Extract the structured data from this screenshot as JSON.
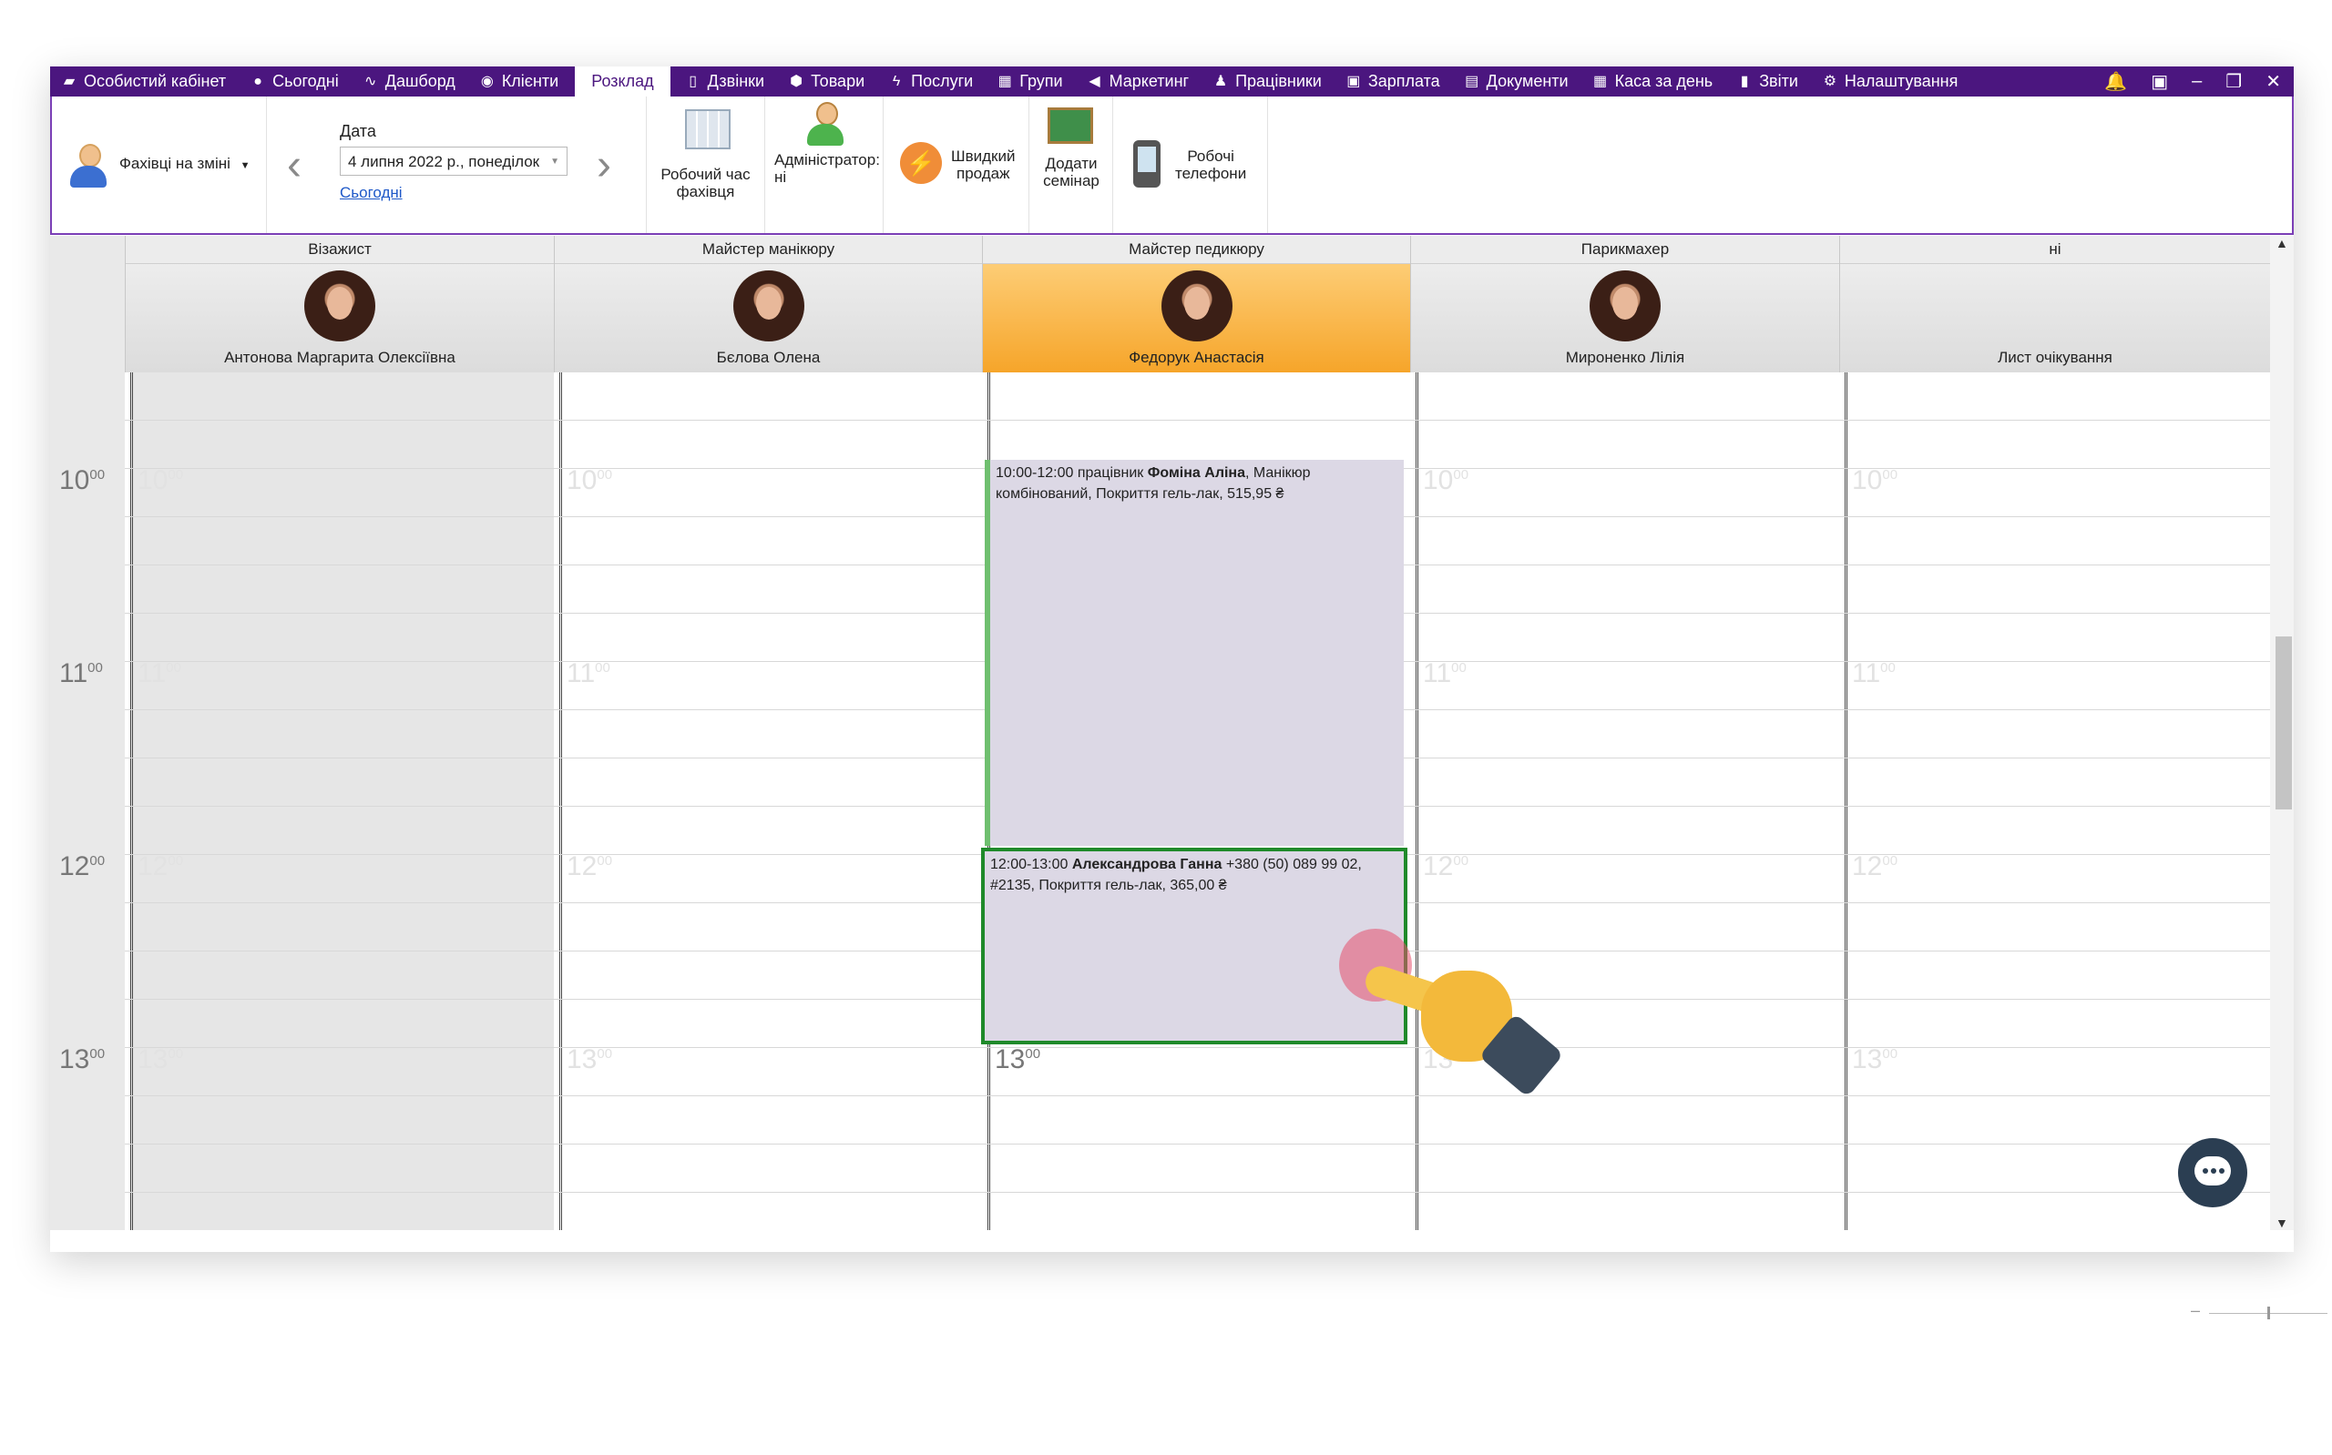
{
  "menu": {
    "items": [
      {
        "label": "Особистий кабінет",
        "icon": "briefcase-icon"
      },
      {
        "label": "Сьогодні",
        "icon": "circle-icon"
      },
      {
        "label": "Дашборд",
        "icon": "pulse-icon"
      },
      {
        "label": "Клієнти",
        "icon": "user-circle-icon"
      },
      {
        "label": "Розклад",
        "icon": "",
        "active": true
      },
      {
        "label": "Дзвінки",
        "icon": "phone-icon"
      },
      {
        "label": "Товари",
        "icon": "box-icon"
      },
      {
        "label": "Послуги",
        "icon": "bolt-icon"
      },
      {
        "label": "Групи",
        "icon": "group-icon"
      },
      {
        "label": "Маркетинг",
        "icon": "megaphone-icon"
      },
      {
        "label": "Працівники",
        "icon": "person-icon"
      },
      {
        "label": "Зарплата",
        "icon": "money-icon"
      },
      {
        "label": "Документи",
        "icon": "document-icon"
      },
      {
        "label": "Каса за день",
        "icon": "calculator-icon"
      },
      {
        "label": "Звіти",
        "icon": "bar-chart-icon"
      },
      {
        "label": "Налаштування",
        "icon": "gear-icon"
      }
    ]
  },
  "toolbar": {
    "staff_filter": "Фахівці на зміні",
    "date_label": "Дата",
    "date_value": "4 липня 2022 р., понеділок",
    "today_link": "Сьогодні",
    "work_time": [
      "Робочий час",
      "фахівця"
    ],
    "admin": [
      "Адміністратор:",
      "ні"
    ],
    "quick_sale": [
      "Швидкий",
      "продаж"
    ],
    "add_seminar": [
      "Додати",
      "семінар"
    ],
    "work_phones": [
      "Робочі",
      "телефони"
    ]
  },
  "columns": [
    {
      "category": "Візажист",
      "name": "Антонова Маргарита Олексіївна",
      "has_avatar": true
    },
    {
      "category": "Майстер манікюру",
      "name": "Бєлова Олена",
      "has_avatar": true
    },
    {
      "category": "Майстер педикюру",
      "name": "Федорук Анастасія",
      "has_avatar": true,
      "selected": true
    },
    {
      "category": "Парикмахер",
      "name": "Мироненко Лілія",
      "has_avatar": true
    },
    {
      "category": "ні",
      "name": "Лист очікування",
      "has_avatar": false
    }
  ],
  "hours": [
    "10",
    "11",
    "12",
    "13"
  ],
  "hour_suffix": "00",
  "appointments": [
    {
      "time": "10:00-12:00 працівник ",
      "client": "Фоміна Аліна",
      "details": ", Манікюр комбінований, Покриття гель-лак, 515,95 ₴"
    },
    {
      "time": "12:00-13:00 ",
      "client": "Александрова Ганна",
      "details": " +380 (50) 089 99 02, #2135, Покриття гель-лак, 365,00 ₴"
    }
  ],
  "colors": {
    "menu_bg": "#4b167f",
    "selected_col": "#f6a52a",
    "appointment_bg": "#dcd8e5",
    "appointment_border": "#1f8a2a"
  }
}
